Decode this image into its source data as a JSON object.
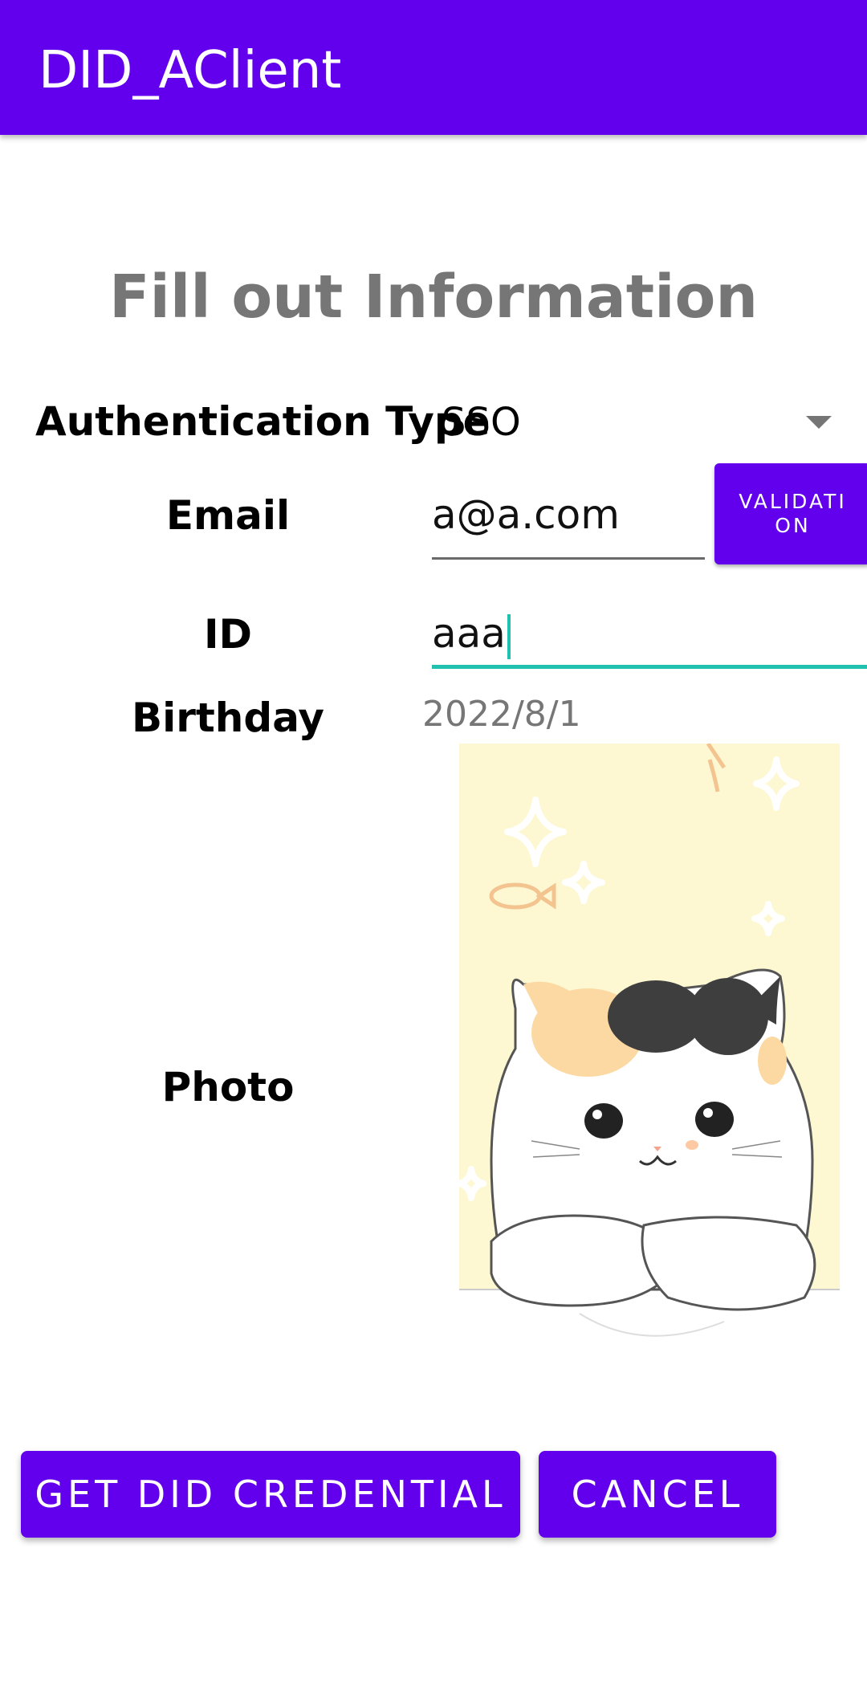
{
  "appbar": {
    "title": "DID_AClient",
    "color": "#6200ee"
  },
  "form": {
    "heading": "Fill out Information",
    "auth_type": {
      "label": "Authentication Type",
      "value": "SSO"
    },
    "email": {
      "label": "Email",
      "value": "a@a.com"
    },
    "validation_button": "VALIDATION",
    "id": {
      "label": "ID",
      "value": "aaa"
    },
    "birthday": {
      "label": "Birthday",
      "value": "2022/8/1"
    },
    "photo": {
      "label": "Photo",
      "image": "cat-illustration"
    }
  },
  "actions": {
    "get_credential": "GET DID CREDENTIAL",
    "cancel": "CANCEL"
  },
  "colors": {
    "accent": "#6200ee",
    "focus": "#21c1b0",
    "heading": "#767676"
  }
}
